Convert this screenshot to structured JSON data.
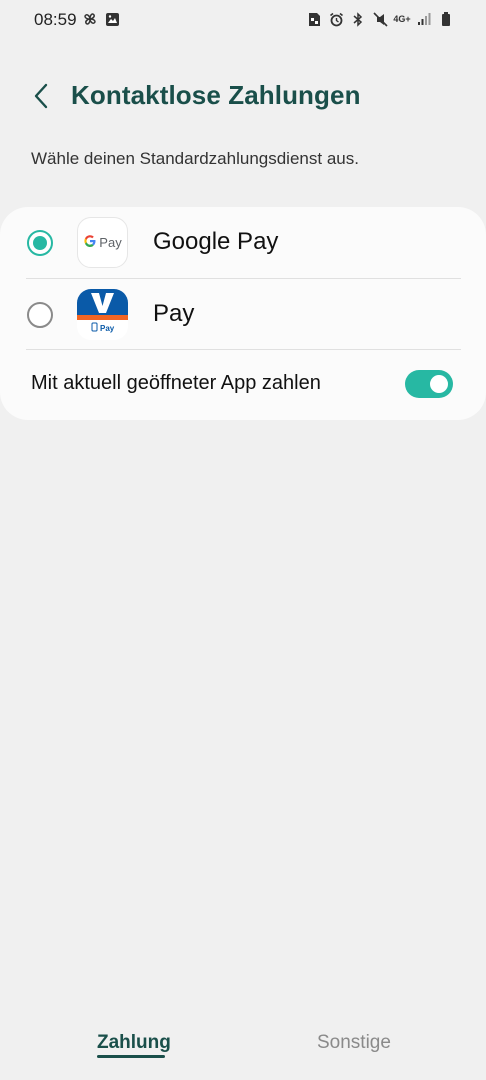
{
  "status_bar": {
    "time": "08:59",
    "left_icons": [
      "pinwheel-icon",
      "image-icon"
    ],
    "right_icons": [
      "sim-icon",
      "alarm-icon",
      "bluetooth-icon",
      "mute-icon",
      "network-4g-icon",
      "signal-icon",
      "battery-icon"
    ],
    "network_label": "4G+"
  },
  "header": {
    "title": "Kontaktlose Zahlungen",
    "subtitle": "Wähle deinen Standardzahlungsdienst aus."
  },
  "payment_apps": [
    {
      "label": "Google Pay",
      "icon": "google-pay-icon",
      "selected": true,
      "icon_text": "Pay"
    },
    {
      "label": "Pay",
      "icon": "vr-pay-icon",
      "selected": false,
      "icon_text": "Pay"
    }
  ],
  "toggle": {
    "label": "Mit aktuell geöffneter App zahlen",
    "on": true
  },
  "tabs": [
    {
      "label": "Zahlung",
      "active": true
    },
    {
      "label": "Sonstige",
      "active": false
    }
  ],
  "colors": {
    "accent": "#27b8a3",
    "title": "#1a4f4a",
    "background": "#f0f0f0",
    "card": "#fbfbfb"
  }
}
